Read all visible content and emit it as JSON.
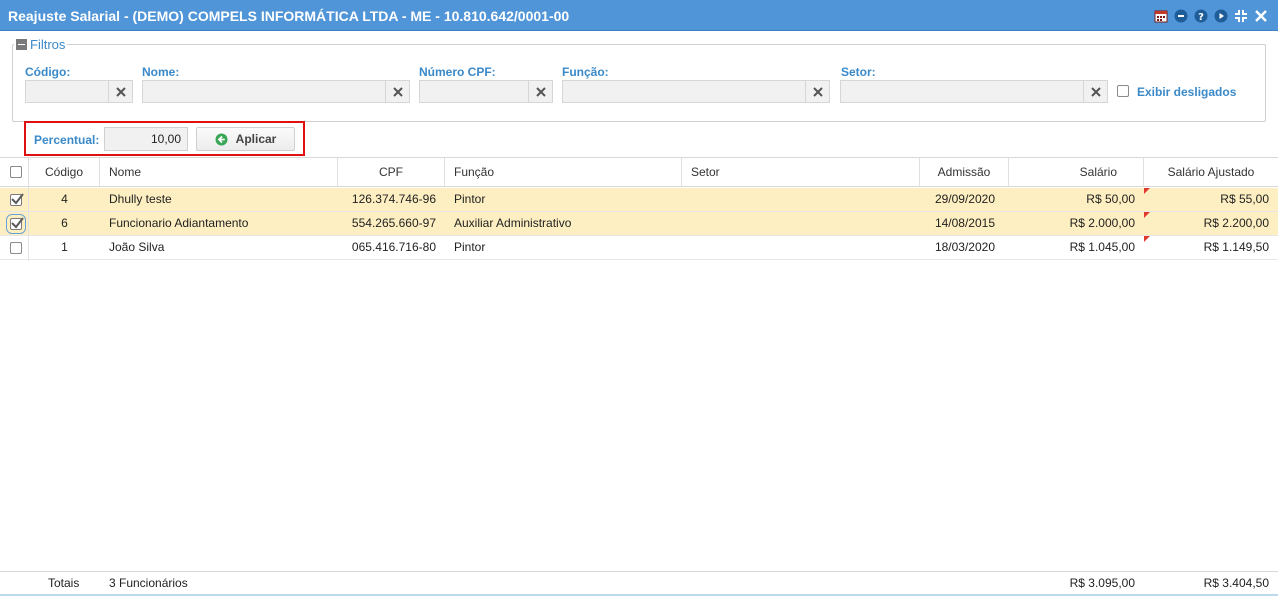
{
  "window": {
    "title": "Reajuste Salarial - (DEMO) COMPELS INFORMÁTICA LTDA - ME - 10.810.642/0001-00",
    "icons": [
      "calendar-icon",
      "minimize-icon",
      "help-icon",
      "play-icon",
      "collapse-icon",
      "close-icon"
    ]
  },
  "filters": {
    "legend": "Filtros",
    "codigo_label": "Código:",
    "codigo_value": "",
    "nome_label": "Nome:",
    "nome_value": "",
    "cpf_label": "Número CPF:",
    "cpf_value": "",
    "funcao_label": "Função:",
    "funcao_value": "",
    "setor_label": "Setor:",
    "setor_value": "",
    "exibir_desligados_label": "Exibir desligados",
    "exibir_desligados_checked": false
  },
  "percent": {
    "label": "Percentual:",
    "value": "10,00",
    "apply_label": "Aplicar"
  },
  "grid": {
    "headers": {
      "codigo": "Código",
      "nome": "Nome",
      "cpf": "CPF",
      "funcao": "Função",
      "setor": "Setor",
      "admissao": "Admissão",
      "salario": "Salário",
      "salario_ajustado": "Salário Ajustado"
    },
    "rows": [
      {
        "selected": true,
        "codigo": "4",
        "nome": "Dhully teste",
        "cpf": "126.374.746-96",
        "funcao": "Pintor",
        "setor": "",
        "admissao": "29/09/2020",
        "salario": "R$ 50,00",
        "salario_ajustado": "R$ 55,00"
      },
      {
        "selected": true,
        "codigo": "6",
        "nome": "Funcionario Adiantamento",
        "cpf": "554.265.660-97",
        "funcao": "Auxiliar Administrativo",
        "setor": "",
        "admissao": "14/08/2015",
        "salario": "R$ 2.000,00",
        "salario_ajustado": "R$ 2.200,00"
      },
      {
        "selected": false,
        "codigo": "1",
        "nome": "João Silva",
        "cpf": "065.416.716-80",
        "funcao": "Pintor",
        "setor": "",
        "admissao": "18/03/2020",
        "salario": "R$ 1.045,00",
        "salario_ajustado": "R$ 1.149,50"
      }
    ]
  },
  "totals": {
    "label": "Totais",
    "count": "3 Funcionários",
    "salario": "R$ 3.095,00",
    "salario_ajustado": "R$ 3.404,50"
  },
  "colors": {
    "titlebar": "#4f95d8",
    "label_blue": "#3a89c9",
    "selected_row": "#fdefc1",
    "highlight_border": "#e01010"
  }
}
